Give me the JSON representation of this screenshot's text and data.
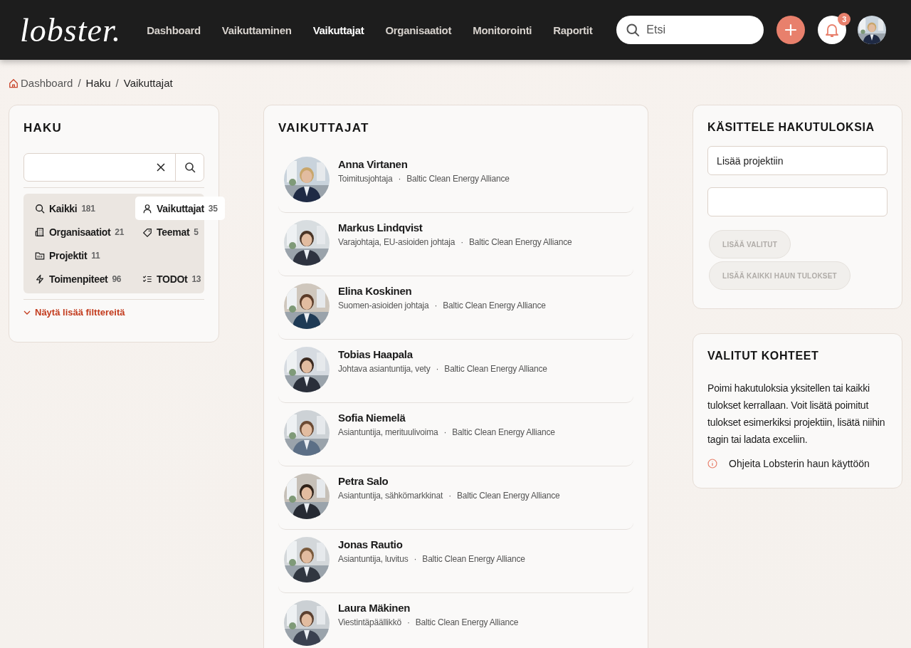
{
  "header": {
    "logo": "lobster.",
    "nav": [
      {
        "label": "Dashboard",
        "selected": false
      },
      {
        "label": "Vaikuttaminen",
        "selected": false
      },
      {
        "label": "Vaikuttajat",
        "selected": true
      },
      {
        "label": "Organisaatiot",
        "selected": false
      },
      {
        "label": "Monitorointi",
        "selected": false
      },
      {
        "label": "Raportit",
        "selected": false
      }
    ],
    "search": {
      "placeholder": "Etsi"
    },
    "notifications": {
      "count": "3"
    }
  },
  "breadcrumb": [
    {
      "kind": "home",
      "label": "Dashboard"
    },
    {
      "kind": "separator",
      "label": "/"
    },
    {
      "kind": "link",
      "label": "Haku"
    },
    {
      "kind": "separator",
      "label": "/"
    },
    {
      "kind": "current",
      "label": "Vaikuttajat"
    }
  ],
  "search_panel": {
    "title": "HAKU",
    "filters": [
      {
        "kind": "all",
        "label": "Kaikki",
        "count": "181",
        "selected": false
      },
      {
        "kind": "people",
        "label": "Vaikuttajat",
        "count": "35",
        "selected": true
      },
      {
        "kind": "organizations",
        "label": "Organisaatiot",
        "count": "21",
        "selected": false
      },
      {
        "kind": "themes",
        "label": "Teemat",
        "count": "5",
        "selected": false
      },
      {
        "kind": "projects",
        "label": "Projektit",
        "count": "11",
        "selected": false
      },
      {
        "kind": "actions",
        "label": "Toimenpiteet",
        "count": "96",
        "selected": false
      },
      {
        "kind": "todos",
        "label": "TODOt",
        "count": "13",
        "selected": false
      }
    ],
    "more_filters": "Näytä lisää filttereitä"
  },
  "results": {
    "title": "VAIKUTTAJAT",
    "people": [
      {
        "name": "Anna Virtanen",
        "role": "Toimitusjohtaja",
        "separator": "·",
        "organization": "Baltic Clean Energy Alliance"
      },
      {
        "name": "Markus Lindqvist",
        "role": "Varajohtaja, EU-asioiden johtaja",
        "separator": "·",
        "organization": "Baltic Clean Energy Alliance"
      },
      {
        "name": "Elina Koskinen",
        "role": "Suomen-asioiden johtaja",
        "separator": "·",
        "organization": "Baltic Clean Energy Alliance"
      },
      {
        "name": "Tobias Haapala",
        "role": "Johtava asiantuntija, vety",
        "separator": "·",
        "organization": "Baltic Clean Energy Alliance"
      },
      {
        "name": "Sofia Niemelä",
        "role": "Asiantuntija, merituulivoima",
        "separator": "·",
        "organization": "Baltic Clean Energy Alliance"
      },
      {
        "name": "Petra Salo",
        "role": "Asiantuntija, sähkömarkkinat",
        "separator": "·",
        "organization": "Baltic Clean Energy Alliance"
      },
      {
        "name": "Jonas Rautio",
        "role": "Asiantuntija, luvitus",
        "separator": "·",
        "organization": "Baltic Clean Energy Alliance"
      },
      {
        "name": "Laura Mäkinen",
        "role": "Viestintäpäällikkö",
        "separator": "·",
        "organization": "Baltic Clean Energy Alliance"
      }
    ]
  },
  "actions": {
    "title": "KÄSITTELE HAKUTULOKSIA",
    "project_field": {
      "value": "Lisää projektiin"
    },
    "buttons": [
      {
        "label": "LISÄÄ VALITUT",
        "disabled": true
      },
      {
        "label": "LISÄÄ KAIKKI HAUN TULOKSET",
        "disabled": true
      }
    ]
  },
  "selected_items": {
    "title": "VALITUT KOHTEET",
    "description": "Poimi hakutuloksia yksitellen tai kaikki tulokset kerrallaan. Voit lisätä poimitut tulokset esimerkiksi projektiin, lisätä niihin tagin tai ladata exceliin.",
    "help_link": "Ohjeita Lobsterin haun käyttöön"
  }
}
